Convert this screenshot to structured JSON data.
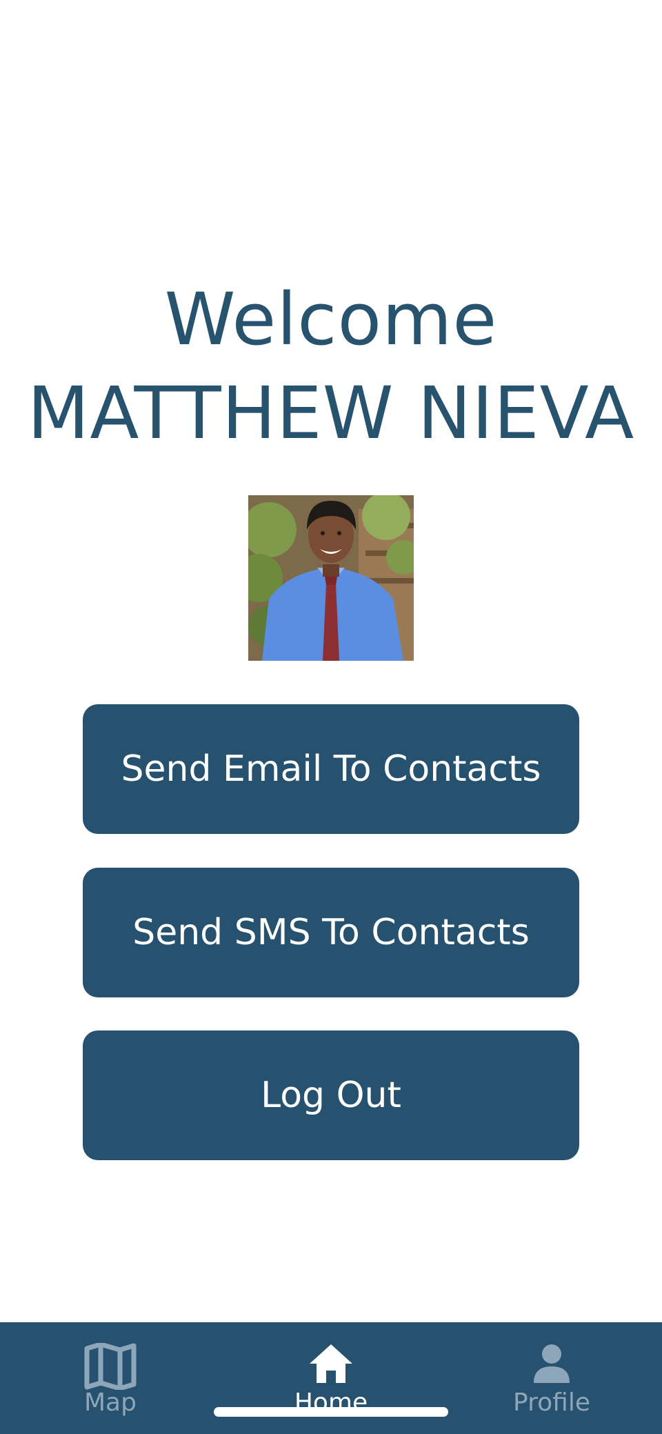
{
  "welcome": {
    "greeting": "Welcome",
    "user_name": "MATTHEW NIEVA"
  },
  "avatar": {
    "icon": "profile-photo"
  },
  "actions": {
    "send_email": "Send Email To Contacts",
    "send_sms": "Send SMS To Contacts",
    "log_out": "Log Out"
  },
  "tab_bar": {
    "tabs": [
      {
        "label": "Map",
        "icon": "map-icon",
        "active": false
      },
      {
        "label": "Home",
        "icon": "home-icon",
        "active": true
      },
      {
        "label": "Profile",
        "icon": "person-icon",
        "active": false
      }
    ]
  },
  "colors": {
    "primary": "#27526f",
    "text_on_primary": "#ffffff",
    "inactive_tab": "#8ea6b9",
    "background": "#ffffff"
  }
}
